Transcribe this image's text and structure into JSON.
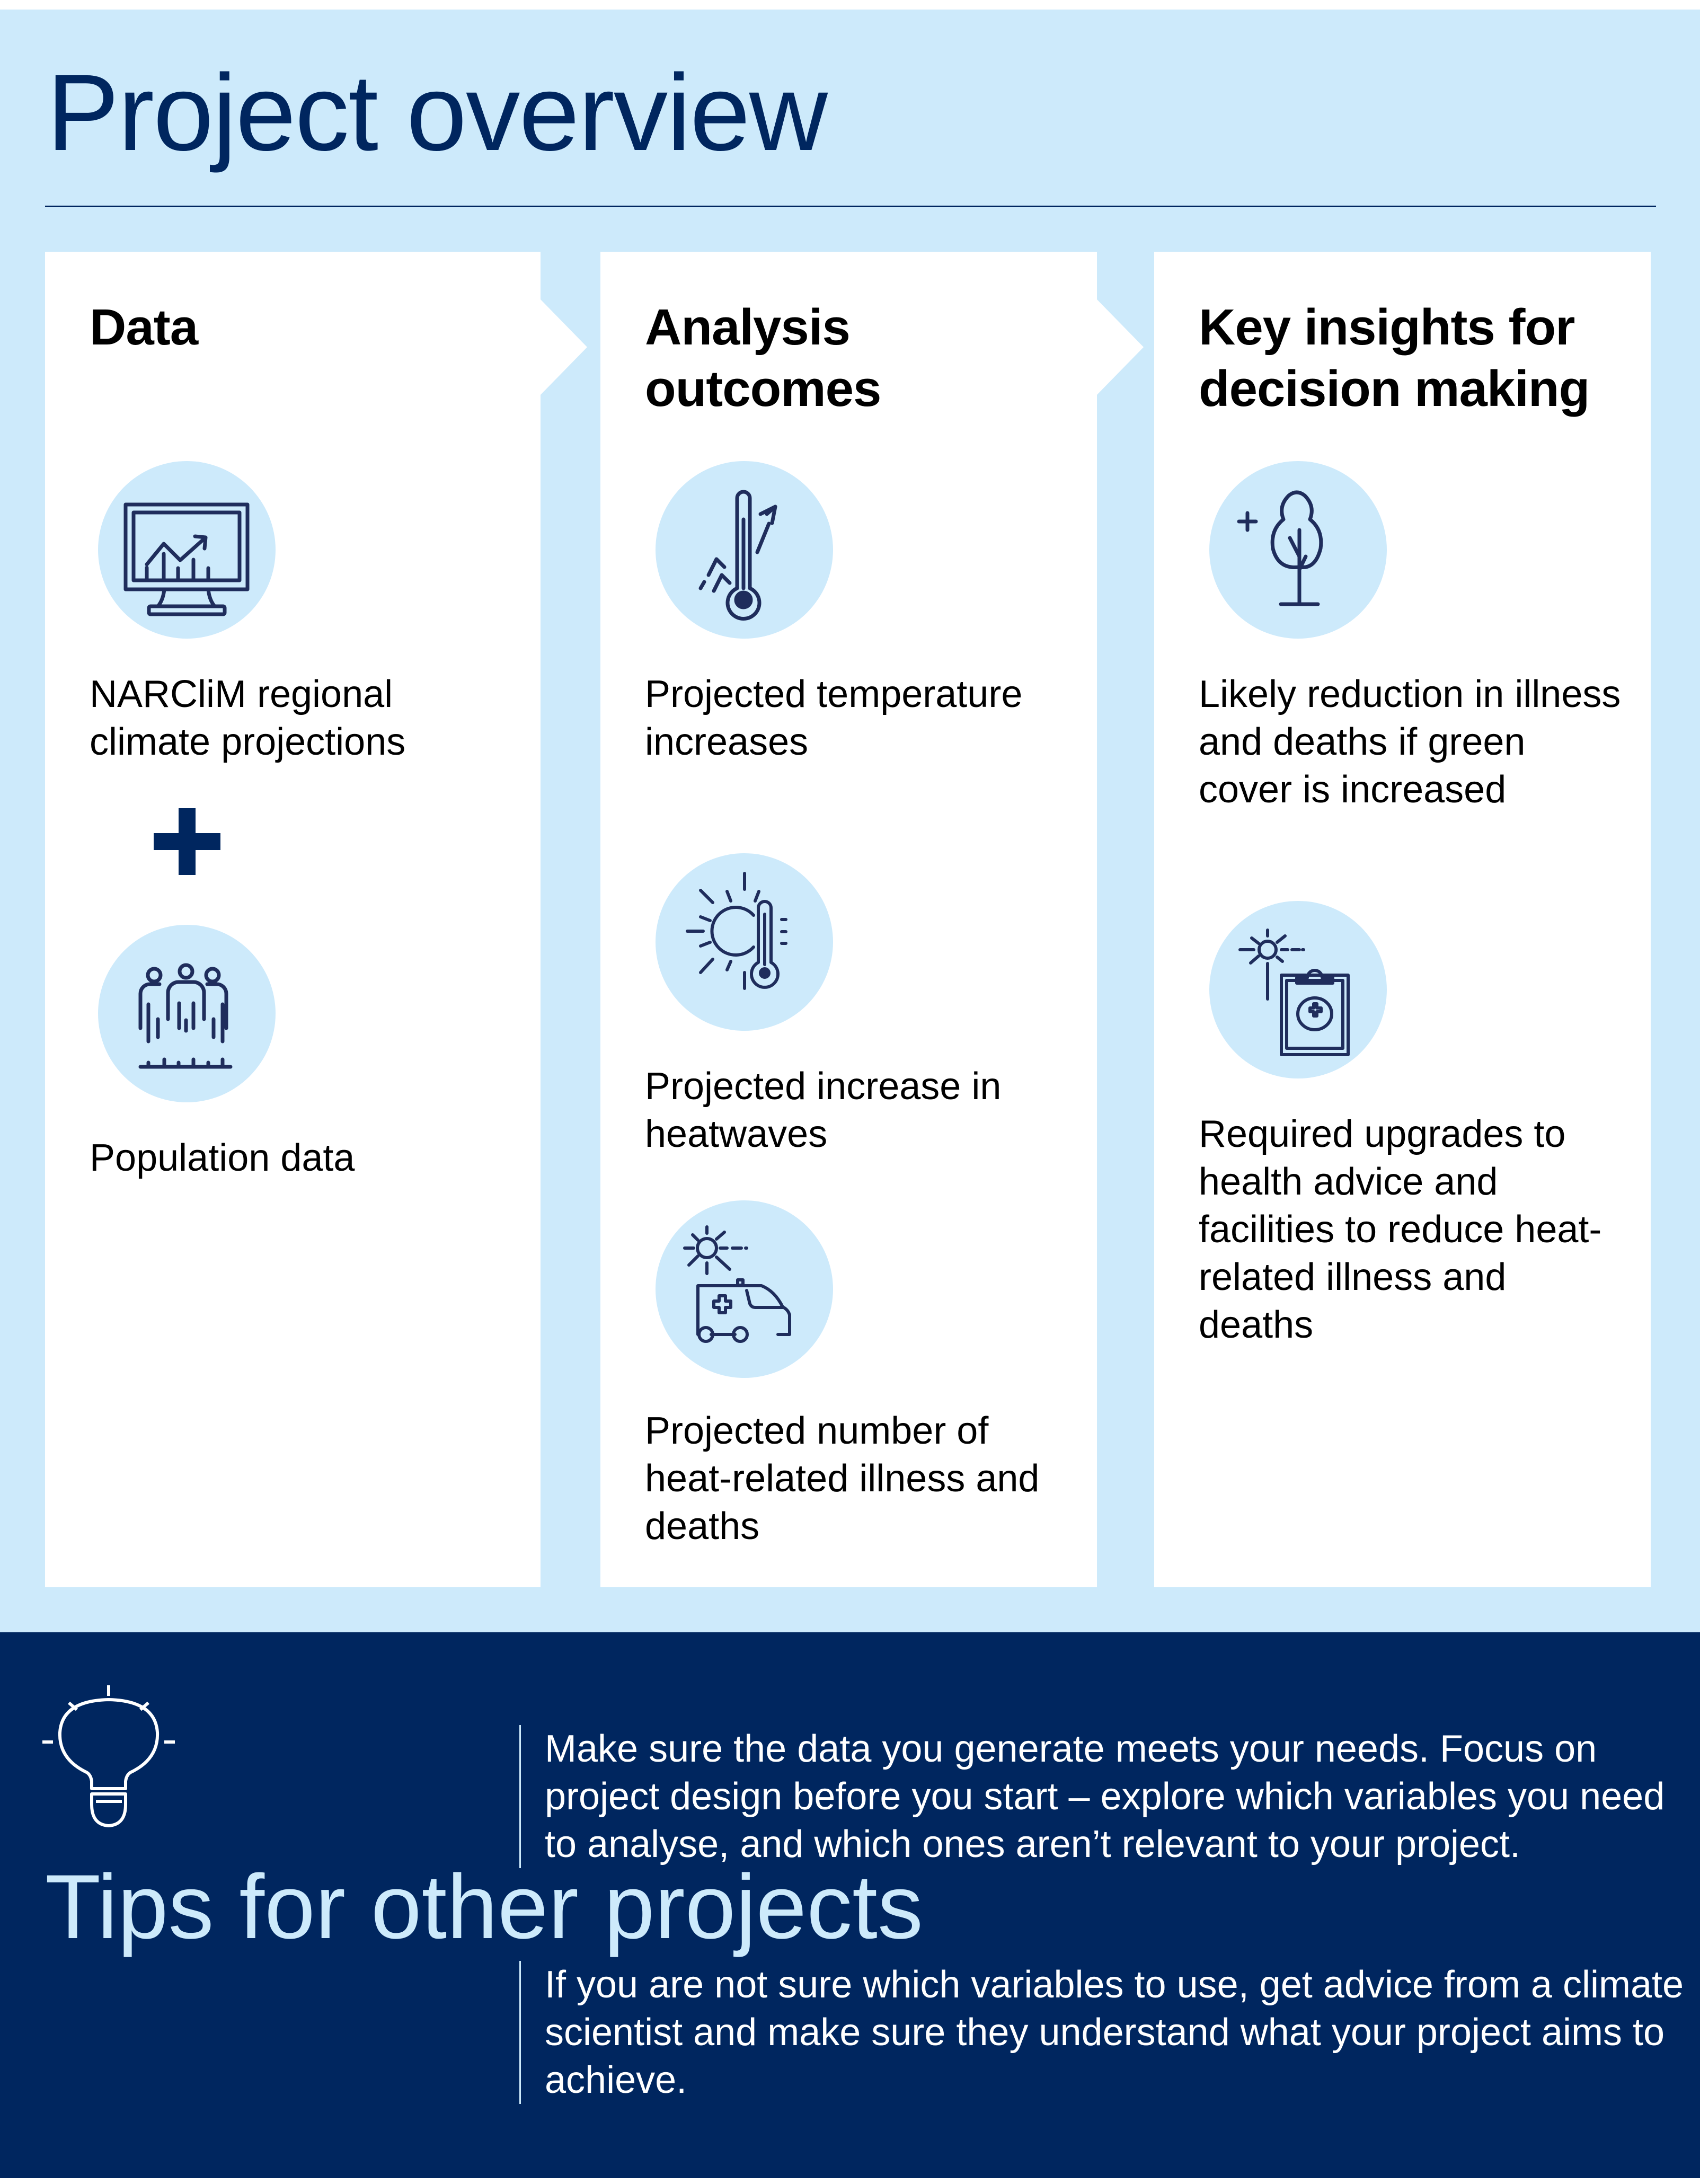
{
  "page": {
    "title": "Project overview"
  },
  "colors": {
    "navy": "#00265f",
    "light_blue": "#cdeafb",
    "icon_stroke": "#1f2d5c"
  },
  "columns": [
    {
      "title": "Data",
      "items": [
        {
          "icon": "monitor-chart-icon",
          "text": "NARCliM regional climate projections"
        },
        {
          "icon": "population-icon",
          "text": "Population data"
        }
      ],
      "connector": "plus-icon"
    },
    {
      "title": "Analysis outcomes",
      "items": [
        {
          "icon": "thermometer-rising-icon",
          "text": "Projected temperature increases"
        },
        {
          "icon": "sun-thermometer-icon",
          "text": "Projected increase in heatwaves"
        },
        {
          "icon": "sun-ambulance-icon",
          "text": "Projected number of heat-related illness and deaths"
        }
      ]
    },
    {
      "title": "Key insights for decision making",
      "items": [
        {
          "icon": "tree-plus-icon",
          "text": "Likely reduction in illness and deaths if green cover is increased"
        },
        {
          "icon": "sun-medical-clipboard-icon",
          "text": "Required upgrades to health advice and facilities to reduce heat-related illness and deaths"
        }
      ]
    }
  ],
  "tips": {
    "icon": "lightbulb-icon",
    "title": "Tips for other projects",
    "items": [
      "Make sure the data you generate meets your needs. Focus on project design before you start – explore which variables you need to analyse, and which ones aren’t relevant to your project.",
      "If you are not sure which variables to use, get advice from a climate scientist and make sure they understand what your project aims to achieve."
    ]
  }
}
